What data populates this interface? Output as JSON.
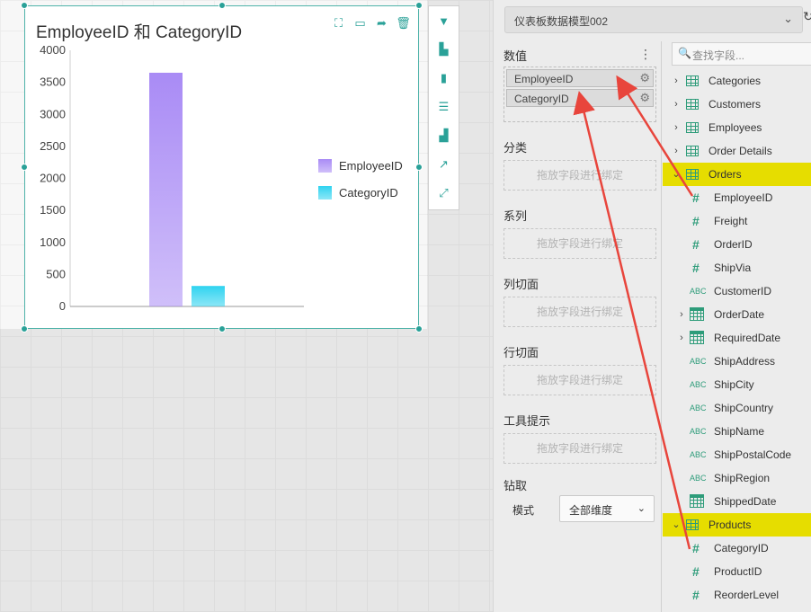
{
  "canvas": {
    "chart": {
      "title": "EmployeeID 和 CategoryID",
      "actions": [
        "fullscreen-icon",
        "comment-icon",
        "share-icon",
        "delete-icon"
      ]
    },
    "side_toolbar": [
      "filter-icon",
      "chart-type-icon",
      "bar-chart-icon",
      "table-icon",
      "combo-chart-icon",
      "trend-icon",
      "resize-icon"
    ]
  },
  "chart_data": {
    "type": "bar",
    "title": "EmployeeID 和 CategoryID",
    "categories": [
      ""
    ],
    "series": [
      {
        "name": "EmployeeID",
        "values": [
          3650
        ],
        "color": "#a98bf5"
      },
      {
        "name": "CategoryID",
        "values": [
          320
        ],
        "color": "#2fd3f0"
      }
    ],
    "y_ticks": [
      "4000",
      "3500",
      "3000",
      "2500",
      "2000",
      "1500",
      "1000",
      "500",
      "0"
    ],
    "ylim": [
      0,
      4000
    ],
    "legend_position": "right",
    "grid": false
  },
  "panel": {
    "model_name": "仪表板数据模型002",
    "sections": {
      "values": "数值",
      "category": "分类",
      "series": "系列",
      "column_slicer": "列切面",
      "row_slicer": "行切面",
      "tooltip": "工具提示",
      "drill": "钻取"
    },
    "value_fields": [
      "EmployeeID",
      "CategoryID"
    ],
    "drop_hint": "拖放字段进行绑定",
    "mode_label": "模式",
    "mode_value": "全部维度",
    "search_placeholder": "查找字段...",
    "tree": [
      {
        "label": "Categories",
        "kind": "table",
        "expanded": false
      },
      {
        "label": "Customers",
        "kind": "table",
        "expanded": false
      },
      {
        "label": "Employees",
        "kind": "table",
        "expanded": false
      },
      {
        "label": "Order Details",
        "kind": "table",
        "expanded": false
      },
      {
        "label": "Orders",
        "kind": "table",
        "expanded": true,
        "highlight": true
      },
      {
        "label": "EmployeeID",
        "kind": "number"
      },
      {
        "label": "Freight",
        "kind": "number"
      },
      {
        "label": "OrderID",
        "kind": "number"
      },
      {
        "label": "ShipVia",
        "kind": "number"
      },
      {
        "label": "CustomerID",
        "kind": "text"
      },
      {
        "label": "OrderDate",
        "kind": "date",
        "expandable": true
      },
      {
        "label": "RequiredDate",
        "kind": "date",
        "expandable": true
      },
      {
        "label": "ShipAddress",
        "kind": "text"
      },
      {
        "label": "ShipCity",
        "kind": "text"
      },
      {
        "label": "ShipCountry",
        "kind": "text"
      },
      {
        "label": "ShipName",
        "kind": "text"
      },
      {
        "label": "ShipPostalCode",
        "kind": "text"
      },
      {
        "label": "ShipRegion",
        "kind": "text"
      },
      {
        "label": "ShippedDate",
        "kind": "date"
      },
      {
        "label": "Products",
        "kind": "table",
        "expanded": true,
        "highlight": true
      },
      {
        "label": "CategoryID",
        "kind": "number"
      },
      {
        "label": "ProductID",
        "kind": "number"
      },
      {
        "label": "ReorderLevel",
        "kind": "number"
      }
    ],
    "abc_glyph": "ABC"
  }
}
